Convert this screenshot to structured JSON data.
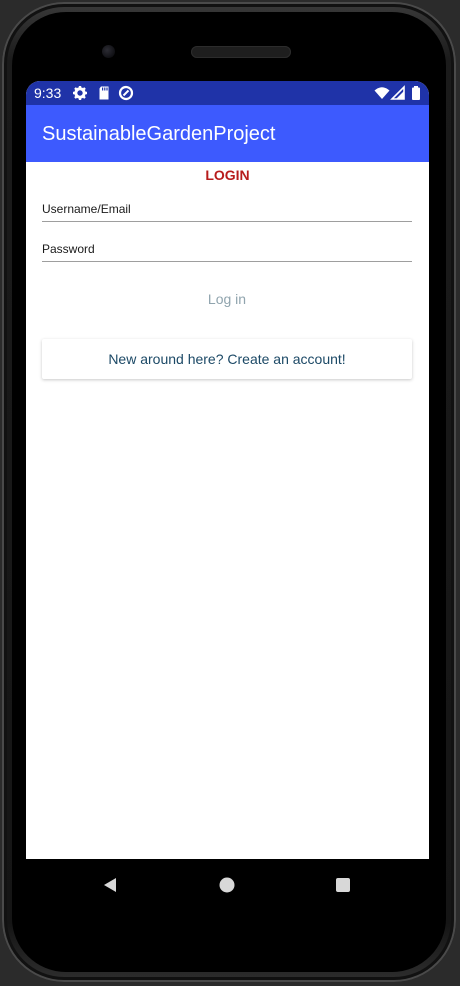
{
  "status_bar": {
    "time": "9:33",
    "icons": [
      "gear-icon",
      "sd-card-icon",
      "data-saver-icon",
      "wifi-icon",
      "signal-icon",
      "battery-icon"
    ]
  },
  "app_bar": {
    "title": "SustainableGardenProject"
  },
  "login": {
    "header": "LOGIN",
    "username_placeholder": "Username/Email",
    "password_placeholder": "Password",
    "login_button": "Log in",
    "create_account_button": "New around here? Create an account!"
  },
  "nav_bar": {
    "icons": [
      "back-icon",
      "home-icon",
      "recents-icon"
    ]
  },
  "colors": {
    "status_bar": "#1f33a8",
    "app_bar": "#3d5afe",
    "login_header": "#b71c1c",
    "login_button_text": "#90a4ae",
    "create_account_text": "#1c4966"
  }
}
